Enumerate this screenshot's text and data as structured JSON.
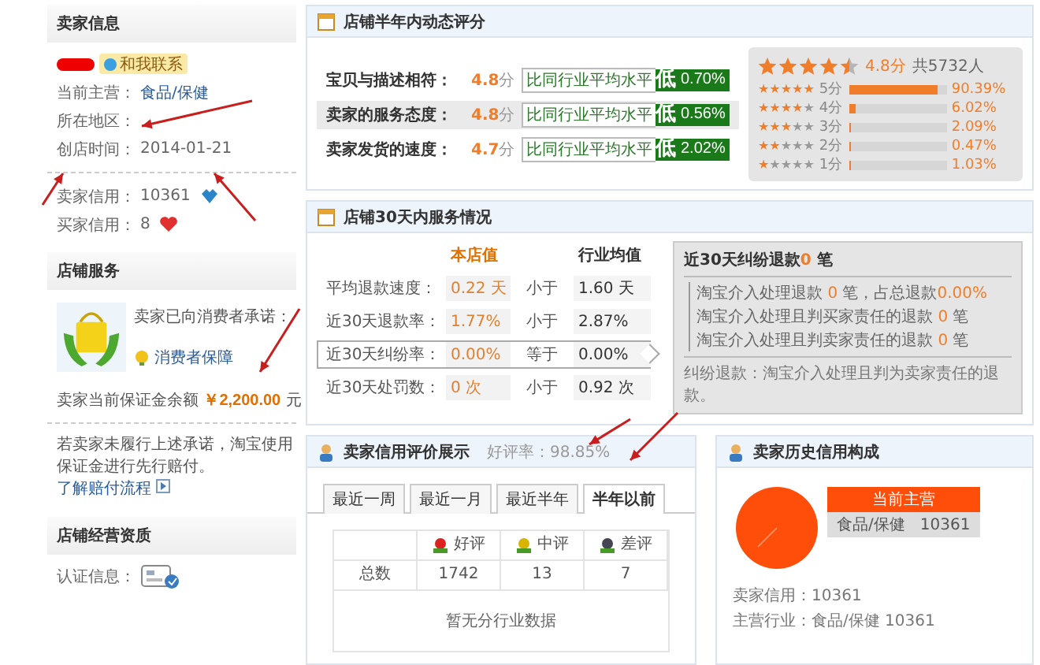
{
  "seller_info": {
    "title": "卖家信息",
    "contact": "和我联系",
    "fields": [
      {
        "label": "当前主营：",
        "value": "食品/保健",
        "kind": "link"
      },
      {
        "label": "所在地区：",
        "kind": "text"
      },
      {
        "label": "创店时间：",
        "value": "2014-01-21",
        "kind": "text"
      }
    ],
    "credits": [
      {
        "label": "卖家信用：",
        "value": "10361",
        "kind": "seller"
      },
      {
        "label": "买家信用：",
        "value": "8",
        "kind": "buyer"
      }
    ]
  },
  "shop_service": {
    "title": "店铺服务",
    "promise": "卖家已向消费者承诺：",
    "badge": "消费者保障",
    "deposit_label": "卖家当前保证金余额",
    "deposit_amount": "￥2,200.00",
    "deposit_unit": "元",
    "note": "若卖家未履行上述承诺，淘宝使用保证金进行先行赔付。",
    "link": "了解赔付流程"
  },
  "qualification": {
    "title": "店铺经营资质",
    "label": "认证信息："
  },
  "dsr": {
    "title": "店铺半年内动态评分",
    "rows": [
      {
        "label": "宝贝与描述相符：",
        "score": "4.8",
        "unit": "分",
        "compare": "比同行业平均水平",
        "trend": "低",
        "percent": "0.70%",
        "selected": false
      },
      {
        "label": "卖家的服务态度：",
        "score": "4.8",
        "unit": "分",
        "compare": "比同行业平均水平",
        "trend": "低",
        "percent": "0.56%",
        "selected": true
      },
      {
        "label": "卖家发货的速度：",
        "score": "4.7",
        "unit": "分",
        "compare": "比同行业平均水平",
        "trend": "低",
        "percent": "2.02%",
        "selected": false
      }
    ],
    "summary": {
      "stars": 4.5,
      "score": "4.8分",
      "total": "共5732人",
      "distribution": [
        {
          "stars": 5,
          "label": "5分",
          "level": 0.9039,
          "percent": "90.39%"
        },
        {
          "stars": 4,
          "label": "4分",
          "level": 0.0602,
          "percent": "6.02%"
        },
        {
          "stars": 3,
          "label": "3分",
          "level": 0.0209,
          "percent": "2.09%"
        },
        {
          "stars": 2,
          "label": "2分",
          "level": 0.0047,
          "percent": "0.47%"
        },
        {
          "stars": 1,
          "label": "1分",
          "level": 0.0103,
          "percent": "1.03%"
        }
      ]
    }
  },
  "service30": {
    "title": "店铺30天内服务情况",
    "col_shop": "本店值",
    "col_industry": "行业均值",
    "rows": [
      {
        "label": "平均退款速度：",
        "value": "0.22 天",
        "compare": "小于",
        "industry": "1.60 天",
        "selected": false
      },
      {
        "label": "近30天退款率：",
        "value": "1.77%",
        "compare": "小于",
        "industry": "2.87%",
        "selected": false
      },
      {
        "label": "近30天纠纷率：",
        "value": "0.00%",
        "compare": "等于",
        "industry": "0.00%",
        "selected": true
      },
      {
        "label": "近30天处罚数：",
        "value": "0 次",
        "compare": "小于",
        "industry": "0.92 次",
        "selected": false
      }
    ],
    "popup": {
      "title": "近30天纠纷退款**0** 笔",
      "items": [
        "淘宝介入处理退款 **0** 笔，占总退款**0.00%**",
        "淘宝介入处理且判买家责任的退款 **0** 笔",
        "淘宝介入处理且判卖家责任的退款 **0** 笔"
      ],
      "footer": "纠纷退款：淘宝介入处理且判为卖家责任的退款。"
    }
  },
  "credit_rating": {
    "title": "卖家信用评价展示",
    "rate": "好评率：98.85%",
    "tabs": [
      {
        "label": "最近一周",
        "selected": false
      },
      {
        "label": "最近一月",
        "selected": false
      },
      {
        "label": "最近半年",
        "selected": false
      },
      {
        "label": "半年以前",
        "selected": true
      }
    ],
    "columns": [
      {
        "label": "好评",
        "kind": "good"
      },
      {
        "label": "中评",
        "kind": "neutral"
      },
      {
        "label": "差评",
        "kind": "bad"
      }
    ],
    "row_label": "总数",
    "values": [
      "1742",
      "13",
      "7"
    ],
    "empty": "暂无分行业数据"
  },
  "credit_history": {
    "title": "卖家历史信用构成",
    "legend_title": "当前主营",
    "legend_item": "食品/保健",
    "legend_value": "10361",
    "lines": [
      "卖家信用：10361",
      "主营行业：食品/保健 10361"
    ]
  }
}
